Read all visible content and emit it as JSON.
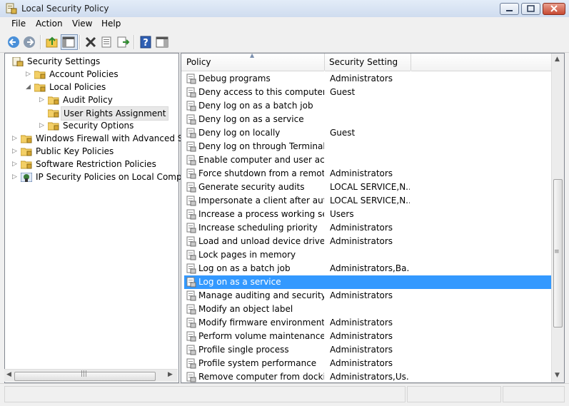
{
  "window": {
    "title": "Local Security Policy"
  },
  "menu": [
    "File",
    "Action",
    "View",
    "Help"
  ],
  "toolbar_icons": [
    "back-arrow-icon",
    "forward-arrow-icon",
    "up-folder-icon",
    "show-hide-tree-icon",
    "delete-icon",
    "properties-icon",
    "export-list-icon",
    "help-icon",
    "details-pane-icon"
  ],
  "tree": [
    {
      "label": "Security Settings",
      "level": 0,
      "expander": "",
      "icon": "security-settings-icon"
    },
    {
      "label": "Account Policies",
      "level": 1,
      "expander": "▷",
      "icon": "folder-icon"
    },
    {
      "label": "Local Policies",
      "level": 1,
      "expander": "◢",
      "icon": "folder-icon"
    },
    {
      "label": "Audit Policy",
      "level": 2,
      "expander": "▷",
      "icon": "folder-icon"
    },
    {
      "label": "User Rights Assignment",
      "level": 2,
      "expander": "",
      "icon": "folder-icon",
      "selected": true
    },
    {
      "label": "Security Options",
      "level": 2,
      "expander": "▷",
      "icon": "folder-icon"
    },
    {
      "label": "Windows Firewall with Advanced Secu",
      "level": 0,
      "expander": "▷",
      "icon": "folder-icon"
    },
    {
      "label": "Public Key Policies",
      "level": 0,
      "expander": "▷",
      "icon": "folder-icon"
    },
    {
      "label": "Software Restriction Policies",
      "level": 0,
      "expander": "▷",
      "icon": "folder-icon"
    },
    {
      "label": "IP Security Policies on Local Compute",
      "level": 0,
      "expander": "▷",
      "icon": "ip-security-icon"
    }
  ],
  "columns": {
    "policy": "Policy",
    "setting": "Security Setting"
  },
  "rows": [
    {
      "policy": "Debug programs",
      "setting": "Administrators"
    },
    {
      "policy": "Deny access to this computer fr...",
      "setting": "Guest"
    },
    {
      "policy": "Deny log on as a batch job",
      "setting": ""
    },
    {
      "policy": "Deny log on as a service",
      "setting": ""
    },
    {
      "policy": "Deny log on locally",
      "setting": "Guest"
    },
    {
      "policy": "Deny log on through Terminal ...",
      "setting": ""
    },
    {
      "policy": "Enable computer and user acco...",
      "setting": ""
    },
    {
      "policy": "Force shutdown from a remote ...",
      "setting": "Administrators"
    },
    {
      "policy": "Generate security audits",
      "setting": "LOCAL SERVICE,N..."
    },
    {
      "policy": "Impersonate a client after authe...",
      "setting": "LOCAL SERVICE,N..."
    },
    {
      "policy": "Increase a process working set",
      "setting": "Users"
    },
    {
      "policy": "Increase scheduling priority",
      "setting": "Administrators"
    },
    {
      "policy": "Load and unload device drivers",
      "setting": "Administrators"
    },
    {
      "policy": "Lock pages in memory",
      "setting": ""
    },
    {
      "policy": "Log on as a batch job",
      "setting": "Administrators,Ba..."
    },
    {
      "policy": "Log on as a service",
      "setting": "",
      "selected": true
    },
    {
      "policy": "Manage auditing and security l...",
      "setting": "Administrators"
    },
    {
      "policy": "Modify an object label",
      "setting": ""
    },
    {
      "policy": "Modify firmware environment ...",
      "setting": "Administrators"
    },
    {
      "policy": "Perform volume maintenance t...",
      "setting": "Administrators"
    },
    {
      "policy": "Profile single process",
      "setting": "Administrators"
    },
    {
      "policy": "Profile system performance",
      "setting": "Administrators"
    },
    {
      "policy": "Remove computer from dockin...",
      "setting": "Administrators,Us..."
    }
  ],
  "colors": {
    "selection": "#3399ff",
    "title_gradient": "#dbe6f4",
    "close_button": "#c74a33"
  }
}
